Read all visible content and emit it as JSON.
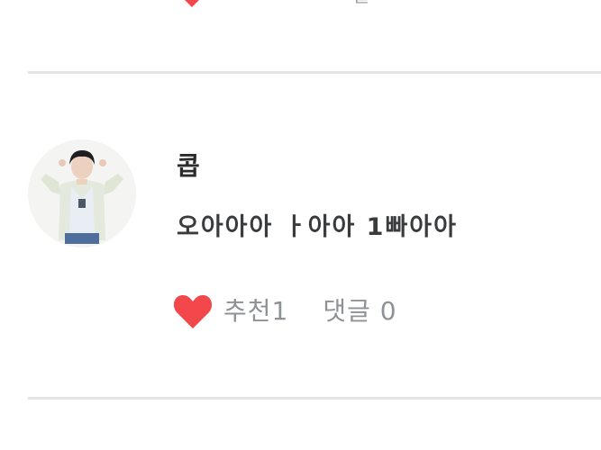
{
  "previous_post": {
    "partial_text": "글"
  },
  "post": {
    "username": "콥",
    "content": "오아아아 ㅏ아아 1빠아아",
    "like_label": "추천1",
    "comment_label": "댓글 0"
  },
  "icons": {
    "like": "heart-icon",
    "avatar": "avatar"
  },
  "colors": {
    "heart": "#f2474b",
    "divider": "#e3e4e6",
    "meta_text": "#8e9296"
  }
}
